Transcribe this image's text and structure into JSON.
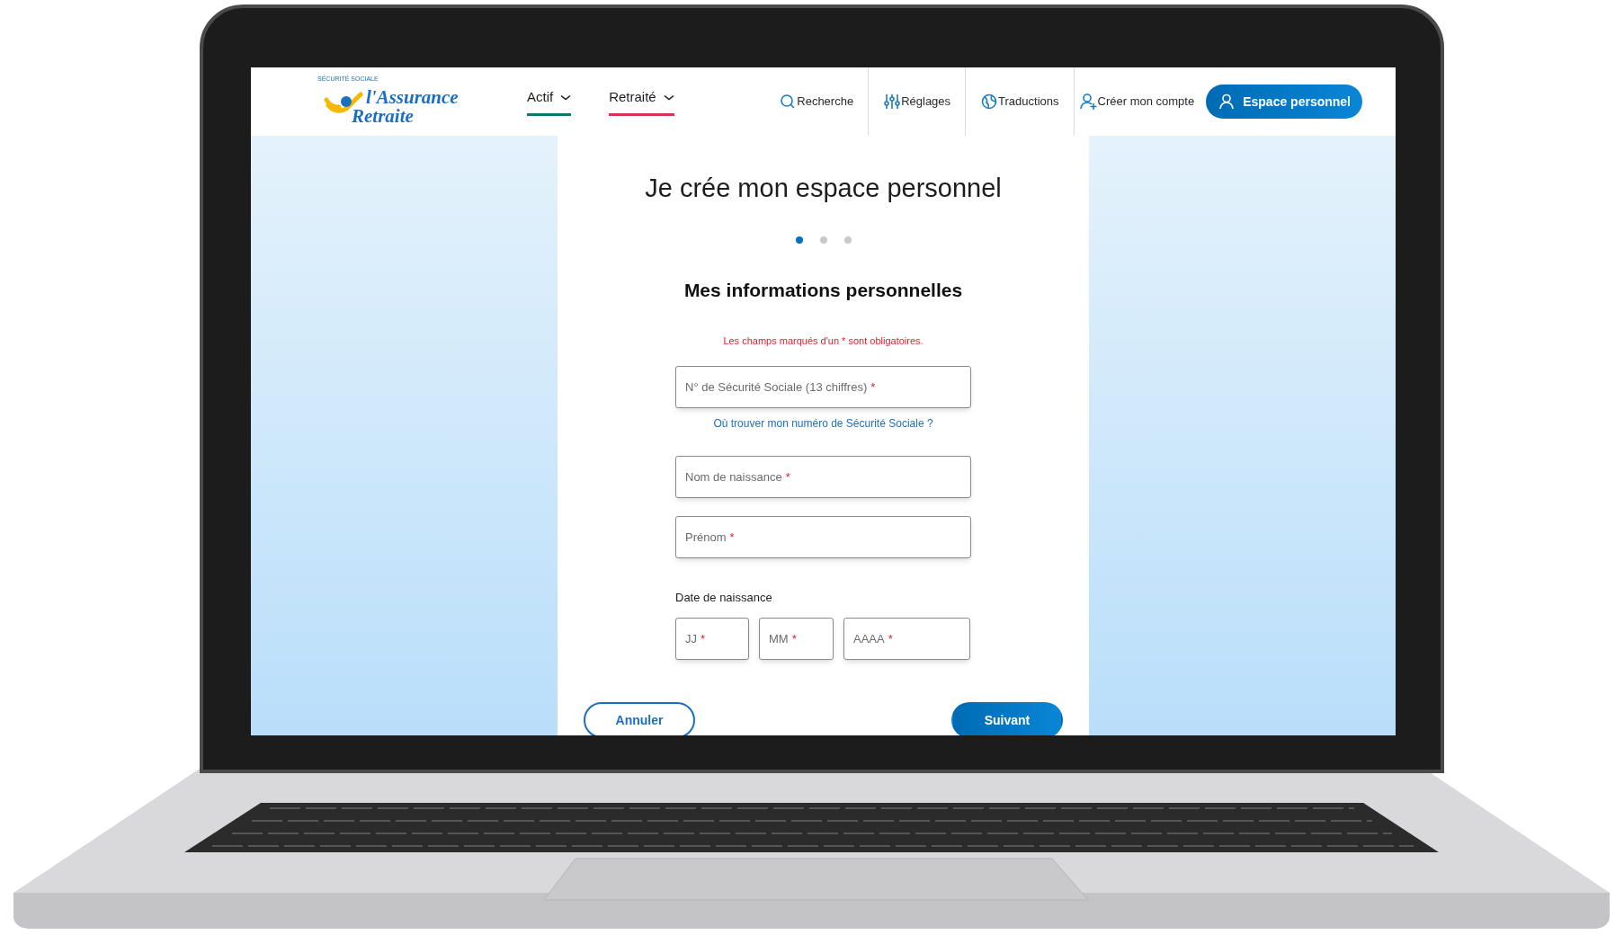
{
  "header": {
    "logo": {
      "arc_text": "SÉCURITÉ SOCIALE",
      "line1": "l'Assurance",
      "line2": "Retraite"
    },
    "nav": [
      {
        "label": "Actif",
        "color": "#0f766e"
      },
      {
        "label": "Retraité",
        "color": "#d6334f"
      }
    ],
    "tools": [
      {
        "label": "Recherche",
        "kind": "search"
      },
      {
        "label": "Réglages",
        "kind": "settings"
      },
      {
        "label": "Traductions",
        "kind": "globe"
      },
      {
        "label": "Créer mon compte",
        "kind": "user-add"
      }
    ],
    "account_button": "Espace personnel"
  },
  "form": {
    "title": "Je crée mon espace personnel",
    "steps": [
      {
        "selected": true
      },
      {
        "selected": false
      },
      {
        "selected": false
      }
    ],
    "heading": "Mes informations personnelles",
    "required_note": "Les champs marqués d'un * sont obligatoires.",
    "ssn_field": {
      "placeholder": "N° de Sécurité Sociale (13 chiffres)",
      "required_mark": "*"
    },
    "help_link": "Où trouver mon numéro de Sécurité Sociale ?",
    "name_fields": [
      {
        "placeholder": "Nom de naissance",
        "required_mark": "*"
      },
      {
        "placeholder": "Prénom",
        "required_mark": "*"
      }
    ],
    "date_label": "Date de naissance",
    "date_fields": [
      {
        "placeholder": "JJ",
        "required_mark": "*"
      },
      {
        "placeholder": "MM",
        "required_mark": "*"
      },
      {
        "placeholder": "AAAA",
        "required_mark": "*"
      }
    ],
    "buttons": [
      {
        "label": "Annuler",
        "kind": "secondary"
      },
      {
        "label": "Suivant",
        "kind": "primary"
      }
    ]
  }
}
